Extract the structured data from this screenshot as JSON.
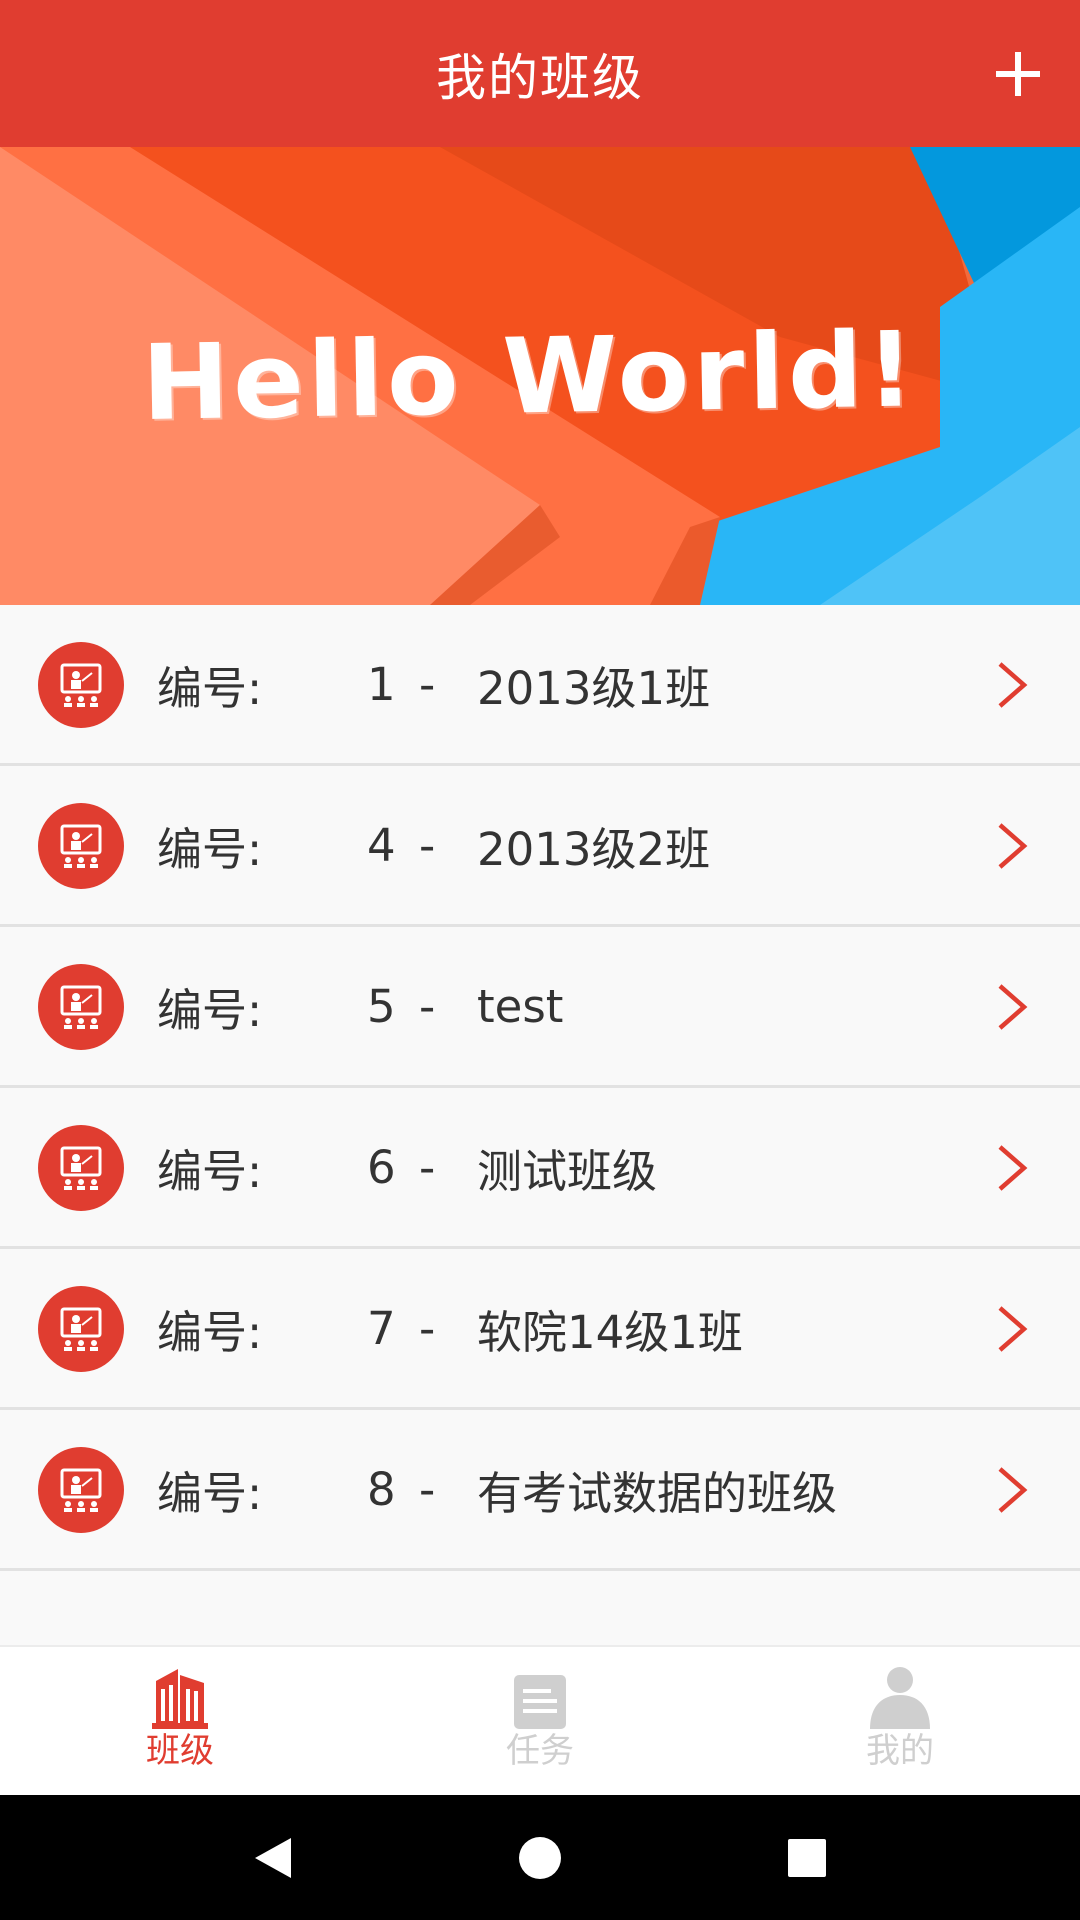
{
  "header": {
    "title": "我的班级",
    "add_icon": "plus-icon"
  },
  "banner": {
    "text": "Hello World!"
  },
  "classes": [
    {
      "prefix": "编号:",
      "id": "1",
      "separator": "-",
      "name": "2013级1班"
    },
    {
      "prefix": "编号:",
      "id": "4",
      "separator": "-",
      "name": "2013级2班"
    },
    {
      "prefix": "编号:",
      "id": "5",
      "separator": "-",
      "name": "test"
    },
    {
      "prefix": "编号:",
      "id": "6",
      "separator": "-",
      "name": "测试班级"
    },
    {
      "prefix": "编号:",
      "id": "7",
      "separator": "-",
      "name": "软院14级1班"
    },
    {
      "prefix": "编号:",
      "id": "8",
      "separator": "-",
      "name": "有考试数据的班级"
    }
  ],
  "bottom_nav": [
    {
      "label": "班级",
      "icon": "building-icon",
      "active": true
    },
    {
      "label": "任务",
      "icon": "document-icon",
      "active": false
    },
    {
      "label": "我的",
      "icon": "person-icon",
      "active": false
    }
  ],
  "system_nav": {
    "back_icon": "back-triangle-icon",
    "home_icon": "home-circle-icon",
    "recents_icon": "recents-square-icon"
  },
  "colors": {
    "primary": "#e03d30",
    "text": "#333333",
    "inactive": "#cfcfcf",
    "background": "#f9f9f9"
  }
}
